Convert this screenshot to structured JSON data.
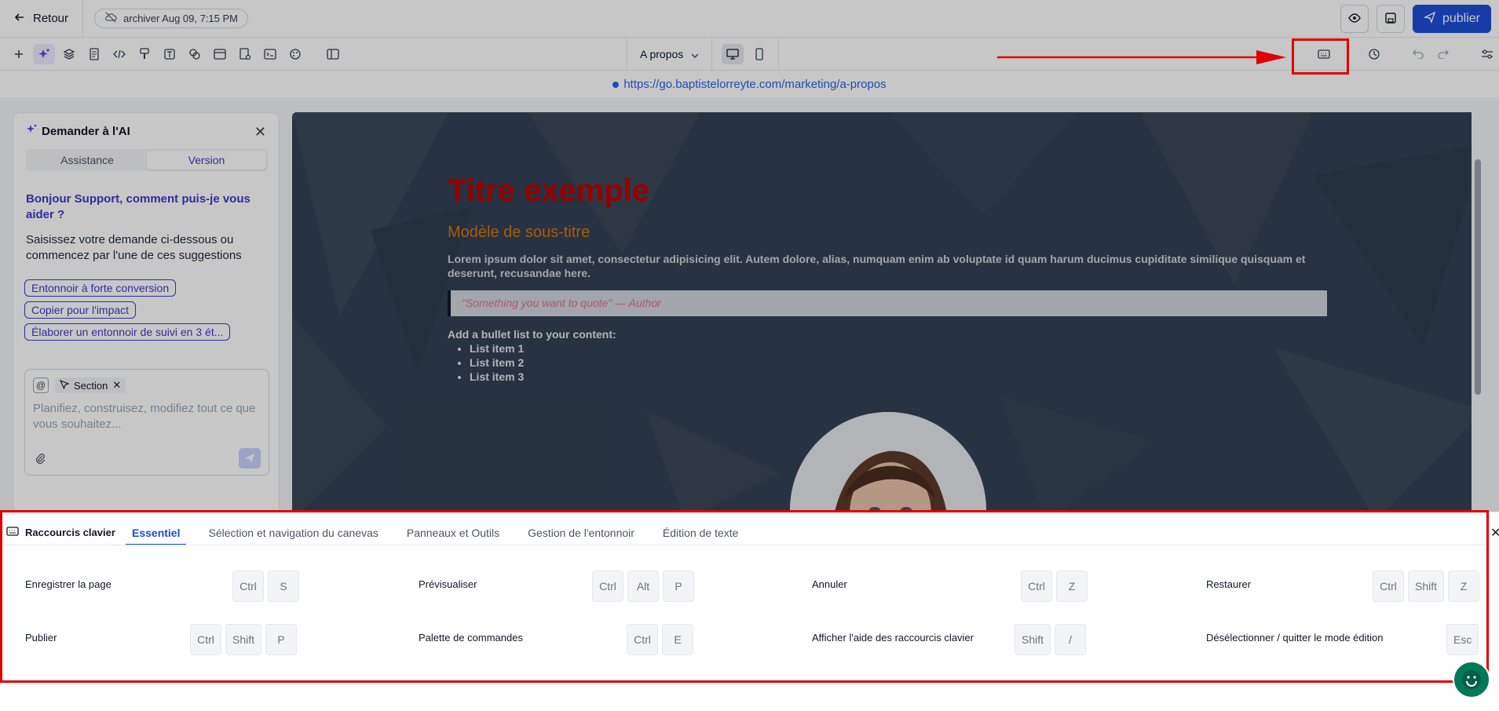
{
  "topbar": {
    "back_label": "Retour",
    "archive_label": "archiver Aug 09, 7:15 PM",
    "publish_label": "publier"
  },
  "toolbar": {
    "page_select_value": "A propos",
    "icons": [
      "plus-icon",
      "ai-sparkle-icon",
      "layers-icon",
      "page-icon",
      "code-icon",
      "paint-icon",
      "text-icon",
      "shapes-icon",
      "layout-icon",
      "form-icon",
      "terminal-icon",
      "palette-icon",
      "columns-icon"
    ]
  },
  "url": "https://go.baptistelorreyte.com/marketing/a-propos",
  "ai_panel": {
    "title": "Demander à l'AI",
    "tab_assistance": "Assistance",
    "tab_version": "Version",
    "greeting": "Bonjour Support, comment puis-je vous aider ?",
    "subtitle": "Saisissez votre demande ci-dessous ou commencez par l'une de ces suggestions",
    "suggestions": [
      "Entonnoir à forte conversion",
      "Copier pour l'impact",
      "Élaborer un entonnoir de suivi en 3 ét..."
    ],
    "section_tag": "Section",
    "placeholder": "Planifiez, construisez, modifiez tout ce que vous souhaitez..."
  },
  "canvas": {
    "title": "Titre exemple",
    "subtitle": "Modèle de sous-titre",
    "lorem": "Lorem ipsum dolor sit amet, consectetur adipisicing elit. Autem dolore, alias, numquam enim ab voluptate id quam harum ducimus cupiditate similique quisquam et deserunt, recusandae here.",
    "quote": "\"Something you want to quote\" — Author",
    "bullet_title": "Add a bullet list to your content:",
    "bullets": [
      "List item 1",
      "List item 2",
      "List item 3"
    ]
  },
  "shortcuts": {
    "title": "Raccourcis clavier",
    "tabs": [
      "Essentiel",
      "Sélection et navigation du canevas",
      "Panneaux et Outils",
      "Gestion de l'entonnoir",
      "Édition de texte"
    ],
    "items": [
      {
        "label": "Enregistrer la page",
        "keys": [
          "Ctrl",
          "S"
        ]
      },
      {
        "label": "Prévisualiser",
        "keys": [
          "Ctrl",
          "Alt",
          "P"
        ]
      },
      {
        "label": "Annuler",
        "keys": [
          "Ctrl",
          "Z"
        ]
      },
      {
        "label": "Restaurer",
        "keys": [
          "Ctrl",
          "Shift",
          "Z"
        ]
      },
      {
        "label": "Publier",
        "keys": [
          "Ctrl",
          "Shift",
          "P"
        ]
      },
      {
        "label": "Palette de commandes",
        "keys": [
          "Ctrl",
          "E"
        ]
      },
      {
        "label": "Afficher l'aide des raccourcis clavier",
        "keys": [
          "Shift",
          "/"
        ]
      },
      {
        "label": "Désélectionner / quitter le mode édition",
        "keys": [
          "Esc"
        ]
      }
    ]
  },
  "colors": {
    "accent": "#1d4ed8",
    "ai_accent": "#4338ca",
    "annotation_red": "#e00000",
    "canvas_bg": "#334155",
    "title_red": "#c00000",
    "subtitle_orange": "#d97706"
  }
}
